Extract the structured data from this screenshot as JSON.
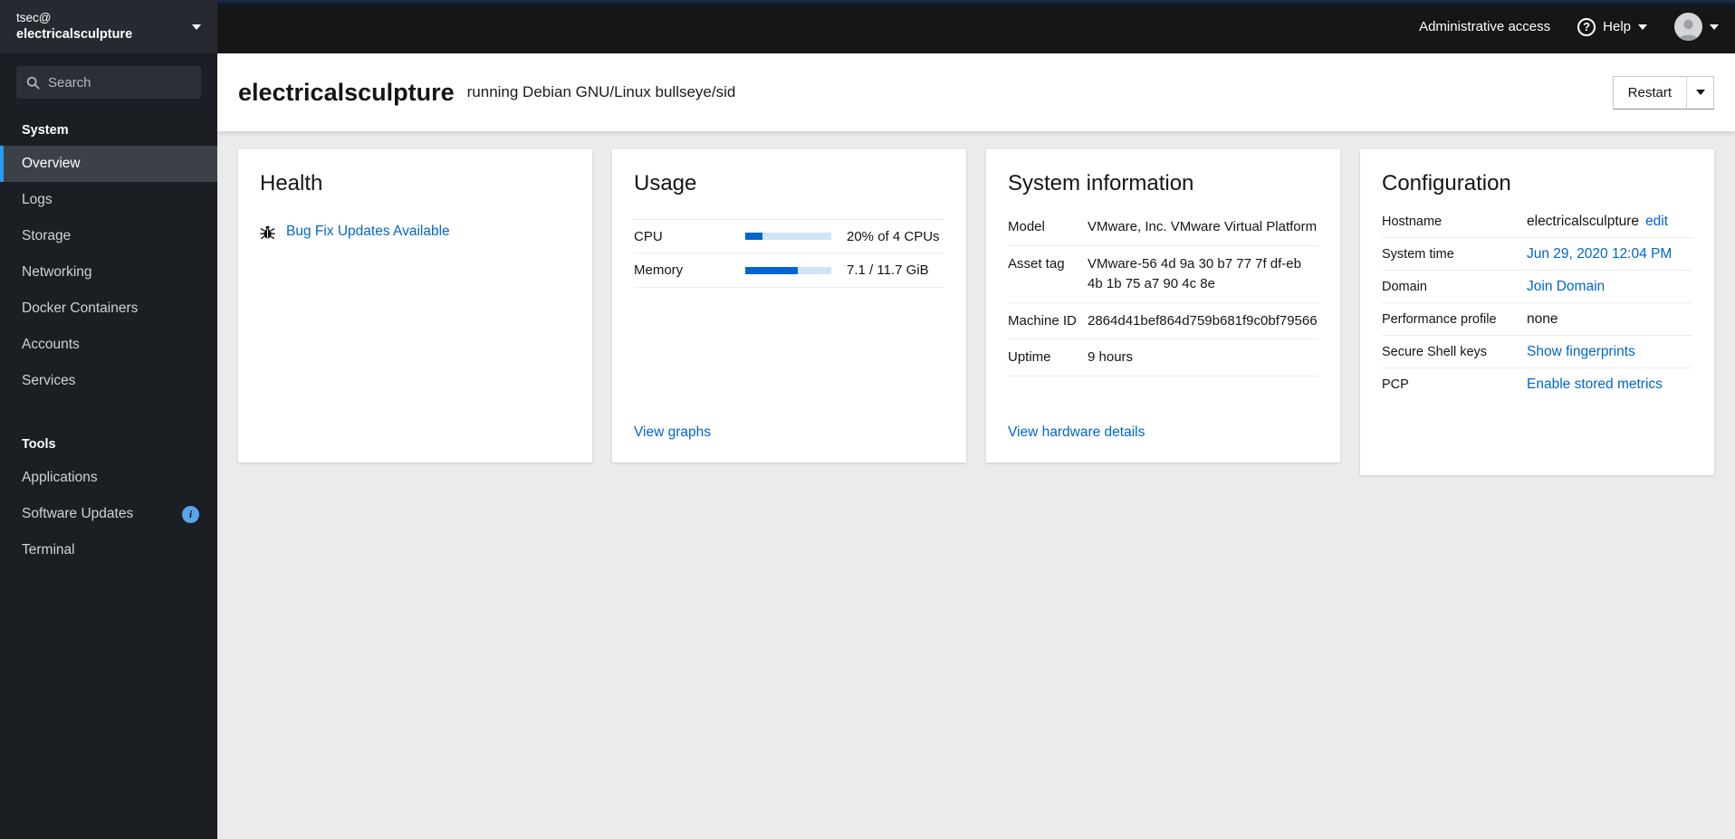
{
  "sidebar": {
    "host_user": "tsec@",
    "host_name": "electricalsculpture",
    "search_placeholder": "Search",
    "sections": [
      {
        "title": "System",
        "items": [
          {
            "label": "Overview",
            "active": true
          },
          {
            "label": "Logs"
          },
          {
            "label": "Storage"
          },
          {
            "label": "Networking"
          },
          {
            "label": "Docker Containers"
          },
          {
            "label": "Accounts"
          },
          {
            "label": "Services"
          }
        ]
      },
      {
        "title": "Tools",
        "items": [
          {
            "label": "Applications"
          },
          {
            "label": "Software Updates",
            "badge": "i"
          },
          {
            "label": "Terminal"
          }
        ]
      }
    ]
  },
  "masthead": {
    "admin_access_label": "Administrative access",
    "help_label": "Help"
  },
  "page_header": {
    "hostname": "electricalsculpture",
    "subtitle": "running Debian GNU/Linux bullseye/sid",
    "restart_label": "Restart"
  },
  "cards": {
    "health": {
      "title": "Health",
      "updates_link": "Bug Fix Updates Available"
    },
    "usage": {
      "title": "Usage",
      "rows": [
        {
          "label": "CPU",
          "value": "20% of 4 CPUs",
          "percent": 20
        },
        {
          "label": "Memory",
          "value": "7.1 / 11.7 GiB",
          "percent": 61
        }
      ],
      "link": "View graphs"
    },
    "system_info": {
      "title": "System information",
      "rows": [
        {
          "label": "Model",
          "value": "VMware, Inc. VMware Virtual Platform"
        },
        {
          "label": "Asset tag",
          "value": "VMware-56 4d 9a 30 b7 77 7f df-eb 4b 1b 75 a7 90 4c 8e"
        },
        {
          "label": "Machine ID",
          "value": "2864d41bef864d759b681f9c0bf79566"
        },
        {
          "label": "Uptime",
          "value": "9 hours"
        }
      ],
      "link": "View hardware details"
    },
    "configuration": {
      "title": "Configuration",
      "rows": [
        {
          "label": "Hostname",
          "value": "electricalsculpture",
          "link": "edit"
        },
        {
          "label": "System time",
          "value": "",
          "link": "Jun 29, 2020 12:04 PM"
        },
        {
          "label": "Domain",
          "value": "",
          "link": "Join Domain"
        },
        {
          "label": "Performance profile",
          "value": "none",
          "link": ""
        },
        {
          "label": "Secure Shell keys",
          "value": "",
          "link": "Show fingerprints"
        },
        {
          "label": "PCP",
          "value": "",
          "link": "Enable stored metrics"
        }
      ]
    }
  },
  "glyphs": {
    "help": "?",
    "info": "i"
  },
  "icons": {
    "search": "magnifier",
    "caret_down": "triangle-down",
    "bug": "bug",
    "help": "question-circle",
    "avatar": "person-silhouette",
    "info_badge": "info-circle"
  },
  "colors": {
    "link": "#0066cc",
    "progress_fill": "#0066cc",
    "progress_track": "#d0e4f6",
    "nav_active_border": "#2b9af3",
    "info_badge_bg": "#5ba3e8",
    "sidebar_bg": "#1b1e23",
    "masthead_bg": "#161616",
    "content_bg": "#ebebeb"
  }
}
